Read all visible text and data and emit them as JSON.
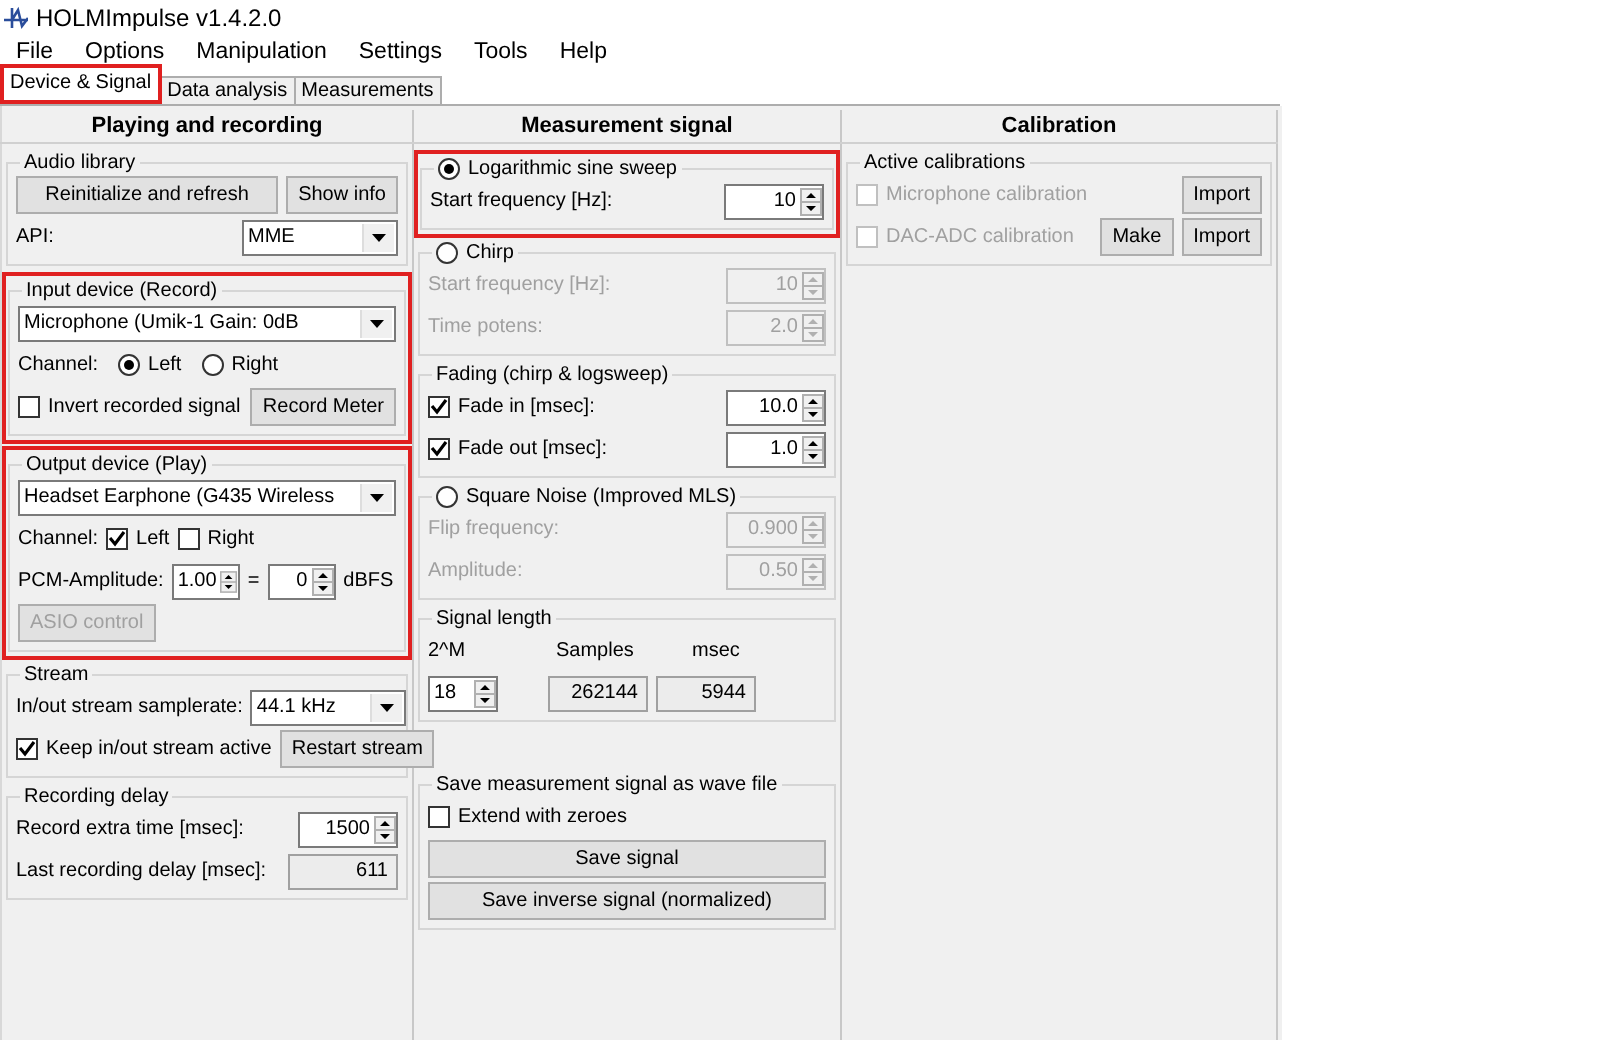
{
  "window": {
    "title": "HOLMImpulse  v1.4.2.0"
  },
  "menu": [
    "File",
    "Options",
    "Manipulation",
    "Settings",
    "Tools",
    "Help"
  ],
  "tabs": [
    {
      "label": "Device & Signal",
      "selected": true,
      "highlighted": true
    },
    {
      "label": "Data analysis",
      "selected": false,
      "highlighted": false
    },
    {
      "label": "Measurements",
      "selected": false,
      "highlighted": false
    }
  ],
  "columns": [
    {
      "title": "Playing and recording",
      "groups": [
        {
          "title": "Audio library",
          "kind": "plain",
          "rows": [
            {
              "controls": [
                {
                  "kind": "button",
                  "label": "Reinitialize and refresh"
                },
                {
                  "kind": "button",
                  "label": "Show info"
                }
              ]
            },
            {
              "controls": [
                {
                  "kind": "label",
                  "label": "API:"
                },
                {
                  "kind": "combo",
                  "value": "MME"
                }
              ]
            }
          ]
        },
        {
          "title": "Input device (Record)",
          "kind": "plain",
          "highlighted": true,
          "rows": [
            {
              "controls": [
                {
                  "kind": "combo",
                  "value": "Microphone (Umik-1  Gain:  0dB"
                }
              ]
            },
            {
              "controls": [
                {
                  "kind": "label",
                  "label": "Channel:"
                },
                {
                  "kind": "radio",
                  "label": "Left",
                  "selected": true
                },
                {
                  "kind": "radio",
                  "label": "Right",
                  "selected": false
                }
              ]
            },
            {
              "controls": [
                {
                  "kind": "check",
                  "label": "Invert recorded signal",
                  "checked": false
                },
                {
                  "kind": "button",
                  "label": "Record Meter"
                }
              ]
            }
          ]
        },
        {
          "title": "Output device (Play)",
          "kind": "plain",
          "highlighted": true,
          "rows": [
            {
              "controls": [
                {
                  "kind": "combo",
                  "value": "Headset Earphone (G435 Wireless"
                }
              ]
            },
            {
              "controls": [
                {
                  "kind": "label",
                  "label": "Channel:"
                },
                {
                  "kind": "check",
                  "label": "Left",
                  "checked": true
                },
                {
                  "kind": "check",
                  "label": "Right",
                  "checked": false
                }
              ]
            },
            {
              "controls": [
                {
                  "kind": "label",
                  "label": "PCM-Amplitude:"
                },
                {
                  "kind": "spin",
                  "value": "1.00"
                },
                {
                  "kind": "label",
                  "label": "="
                },
                {
                  "kind": "spin",
                  "value": "0"
                },
                {
                  "kind": "label",
                  "label": "dBFS"
                }
              ]
            },
            {
              "controls": [
                {
                  "kind": "button",
                  "label": "ASIO control",
                  "disabled": true
                }
              ]
            }
          ]
        },
        {
          "title": "Stream",
          "kind": "plain",
          "rows": [
            {
              "controls": [
                {
                  "kind": "label",
                  "label": "In/out stream samplerate:"
                },
                {
                  "kind": "combo",
                  "value": "44.1 kHz"
                }
              ]
            },
            {
              "controls": [
                {
                  "kind": "check",
                  "label": "Keep in/out stream active",
                  "checked": true
                },
                {
                  "kind": "button",
                  "label": "Restart stream"
                }
              ]
            }
          ]
        },
        {
          "title": "Recording delay",
          "kind": "plain",
          "rows": [
            {
              "controls": [
                {
                  "kind": "label",
                  "label": "Record extra time [msec]:"
                },
                {
                  "kind": "spin",
                  "value": "1500"
                }
              ]
            },
            {
              "controls": [
                {
                  "kind": "label",
                  "label": "Last recording delay [msec]:"
                },
                {
                  "kind": "readout",
                  "value": "611"
                }
              ]
            }
          ]
        }
      ]
    },
    {
      "title": "Measurement signal",
      "groups": [
        {
          "title": "Logarithmic sine sweep",
          "kind": "radio",
          "selected": true,
          "highlighted": true,
          "rows": [
            {
              "controls": [
                {
                  "kind": "label",
                  "label": "Start frequency [Hz]:"
                },
                {
                  "kind": "spin",
                  "value": "10"
                }
              ]
            }
          ]
        },
        {
          "title": "Chirp",
          "kind": "radio",
          "selected": false,
          "rows": [
            {
              "controls": [
                {
                  "kind": "label",
                  "label": "Start frequency [Hz]:",
                  "disabled": true
                },
                {
                  "kind": "spin",
                  "value": "10",
                  "disabled": true
                }
              ]
            },
            {
              "controls": [
                {
                  "kind": "label",
                  "label": "Time potens:",
                  "disabled": true
                },
                {
                  "kind": "spin",
                  "value": "2.0",
                  "disabled": true
                }
              ]
            }
          ]
        },
        {
          "title": "Fading (chirp & logsweep)",
          "kind": "plain",
          "rows": [
            {
              "controls": [
                {
                  "kind": "check",
                  "label": "Fade in [msec]:",
                  "checked": true
                },
                {
                  "kind": "spin",
                  "value": "10.0"
                }
              ]
            },
            {
              "controls": [
                {
                  "kind": "check",
                  "label": "Fade out [msec]:",
                  "checked": true
                },
                {
                  "kind": "spin",
                  "value": "1.0"
                }
              ]
            }
          ]
        },
        {
          "title": "Square Noise (Improved MLS)",
          "kind": "radio",
          "selected": false,
          "rows": [
            {
              "controls": [
                {
                  "kind": "label",
                  "label": "Flip frequency:",
                  "disabled": true
                },
                {
                  "kind": "spin",
                  "value": "0.900",
                  "disabled": true
                }
              ]
            },
            {
              "controls": [
                {
                  "kind": "label",
                  "label": "Amplitude:",
                  "disabled": true
                },
                {
                  "kind": "spin",
                  "value": "0.50",
                  "disabled": true
                }
              ]
            }
          ]
        },
        {
          "title": "Signal length",
          "kind": "plain",
          "rows": [
            {
              "controls": [
                {
                  "kind": "label",
                  "label": "2^M"
                },
                {
                  "kind": "label",
                  "label": "Samples"
                },
                {
                  "kind": "label",
                  "label": "msec"
                }
              ]
            },
            {
              "controls": [
                {
                  "kind": "spin",
                  "value": "18"
                },
                {
                  "kind": "readout",
                  "value": "262144"
                },
                {
                  "kind": "readout",
                  "value": "5944"
                }
              ]
            }
          ]
        },
        {
          "title": "Save measurement signal as wave file",
          "kind": "plain",
          "rows": [
            {
              "controls": [
                {
                  "kind": "check",
                  "label": "Extend with zeroes",
                  "checked": false
                }
              ]
            },
            {
              "controls": [
                {
                  "kind": "button",
                  "label": "Save signal"
                }
              ]
            },
            {
              "controls": [
                {
                  "kind": "button",
                  "label": "Save inverse signal (normalized)"
                }
              ]
            }
          ]
        }
      ]
    },
    {
      "title": "Calibration",
      "groups": [
        {
          "title": "Active calibrations",
          "kind": "plain",
          "rows": [
            {
              "controls": [
                {
                  "kind": "check",
                  "label": "Microphone calibration",
                  "checked": false,
                  "disabled": true
                },
                {
                  "kind": "button",
                  "label": "Import"
                }
              ]
            },
            {
              "controls": [
                {
                  "kind": "check",
                  "label": "DAC-ADC calibration",
                  "checked": false,
                  "disabled": true
                },
                {
                  "kind": "button",
                  "label": "Make"
                },
                {
                  "kind": "button",
                  "label": "Import"
                }
              ]
            }
          ]
        }
      ]
    }
  ]
}
